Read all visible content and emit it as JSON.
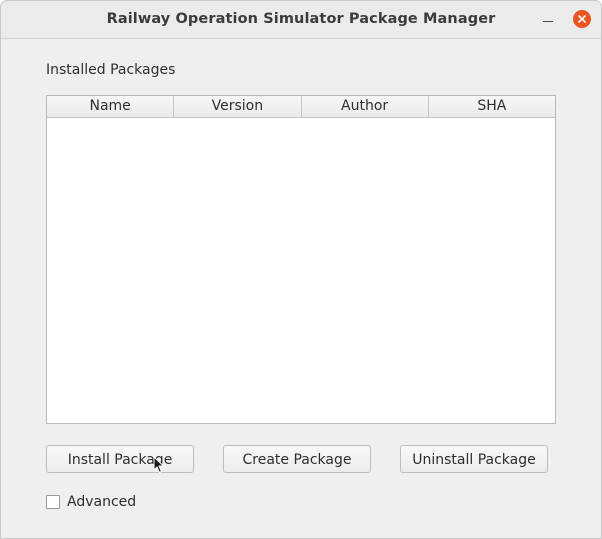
{
  "window": {
    "title": "Railway Operation Simulator Package Manager"
  },
  "installed": {
    "label": "Installed Packages",
    "columns": [
      "Name",
      "Version",
      "Author",
      "SHA"
    ],
    "rows": []
  },
  "buttons": {
    "install_label": "Install Package",
    "create_label": "Create Package",
    "uninstall_label": "Uninstall Package"
  },
  "advanced": {
    "label": "Advanced",
    "checked": false
  },
  "icons": {
    "minimize": "minimize-icon",
    "close": "close-icon",
    "cursor": "mouse-pointer-icon"
  },
  "colors": {
    "close_button": "#e95420",
    "window_bg": "#efefef"
  }
}
